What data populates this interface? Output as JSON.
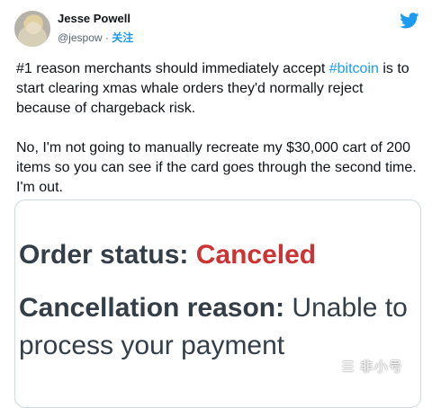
{
  "author": {
    "name": "Jesse Powell",
    "handle": "@jespow",
    "separator": "·",
    "follow_label": "关注",
    "avatar_icon": "user-avatar-photo"
  },
  "platform_icon": "twitter-bird-icon",
  "brand_color": "#1d9bf0",
  "tweet": {
    "para1_before": "#1 reason merchants should immediately accept ",
    "hashtag": "#bitcoin",
    "para1_after": " is to start clearing xmas whale orders they'd normally reject because of chargeback risk.",
    "para2": "No, I'm not going to manually recreate my $30,000 cart of 200 items so you can see if the card goes through the second time. I'm out."
  },
  "card": {
    "order_status_label": "Order status:",
    "order_status_value": "Canceled",
    "cancellation_label": "Cancellation reason:",
    "cancellation_value": "Unable to process your payment",
    "status_color": "#cc3333"
  },
  "watermark": "非小号"
}
